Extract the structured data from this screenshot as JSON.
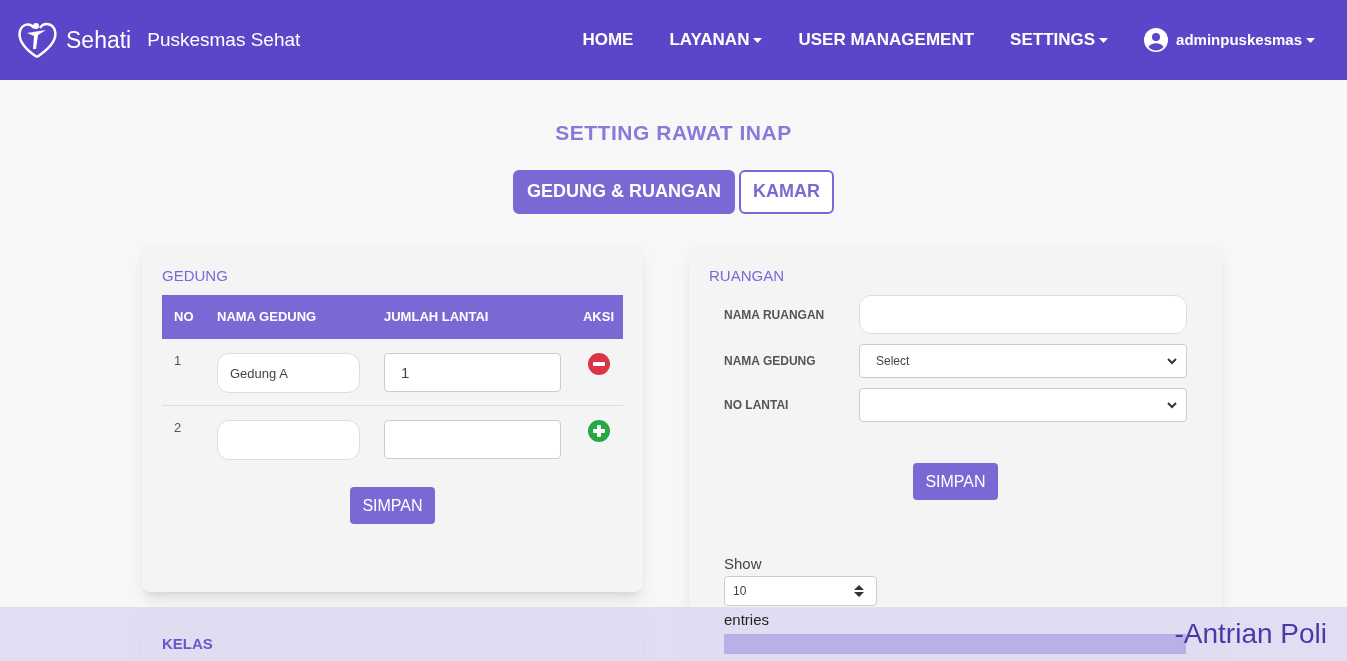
{
  "navbar": {
    "brand": "Sehati",
    "site_name": "Puskesmas Sehat",
    "menu": [
      {
        "label": "HOME",
        "dropdown": false
      },
      {
        "label": "LAYANAN",
        "dropdown": true
      },
      {
        "label": "USER MANAGEMENT",
        "dropdown": false
      },
      {
        "label": "SETTINGS",
        "dropdown": true
      }
    ],
    "user": {
      "label": "adminpuskesmas",
      "dropdown": true
    }
  },
  "page_title": "SETTING RAWAT INAP",
  "tabs": [
    {
      "label": "GEDUNG & RUANGAN",
      "selected": true
    },
    {
      "label": "KAMAR",
      "selected": false
    }
  ],
  "gedung": {
    "title": "GEDUNG",
    "columns": [
      "NO",
      "NAMA GEDUNG",
      "JUMLAH LANTAI",
      "AKSI"
    ],
    "rows": [
      {
        "no": "1",
        "nama_gedung": "Gedung A",
        "jumlah_lantai": "1",
        "kind": "remove"
      },
      {
        "no": "2",
        "kind": "add"
      }
    ],
    "button": "SIMPAN"
  },
  "ruangan": {
    "title": "RUANGAN",
    "fields": [
      {
        "label": "NAMA RUANGAN",
        "kind": "input"
      },
      {
        "label": "NAMA GEDUNG",
        "kind": "select",
        "value": "Select"
      },
      {
        "label": "NO LANTAI",
        "kind": "select"
      }
    ],
    "button": "SIMPAN",
    "show_label": "Show",
    "page_length": "10",
    "entries_label": "entries"
  },
  "kelas": {
    "title": "KELAS"
  },
  "footer_marquee": "-Antrian Poli"
}
